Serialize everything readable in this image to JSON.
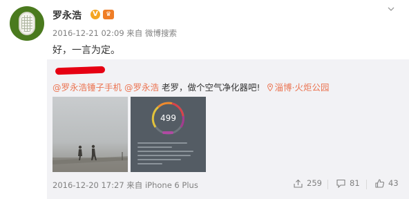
{
  "post": {
    "author": "罗永浩",
    "badges": {
      "verified": "V",
      "member": "♛"
    },
    "timestamp": "2016-12-21 02:09",
    "source_prefix": "来自",
    "source": "微博搜索",
    "text": "好，一言为定。"
  },
  "quoted": {
    "mention_1": "@罗永浩锤子手机",
    "mention_2": "@罗永浩",
    "text": " 老罗，做个空气净化器吧!",
    "location": "淄博·火炬公园",
    "gauge_value": "499",
    "timestamp": "2016-12-20 17:27",
    "source_prefix": "来自",
    "source": "iPhone 6 Plus",
    "reposts": "259",
    "comments": "81",
    "likes": "43"
  },
  "colors": {
    "link": "#eb7350",
    "meta": "#808080",
    "quote_bg": "#f2f2f5",
    "verified_badge": "#f4a623"
  },
  "icons": {
    "chevron": "chevron-down-icon",
    "location": "location-pin-icon",
    "repost": "repost-icon",
    "comment": "comment-icon",
    "like": "thumbs-up-icon"
  }
}
